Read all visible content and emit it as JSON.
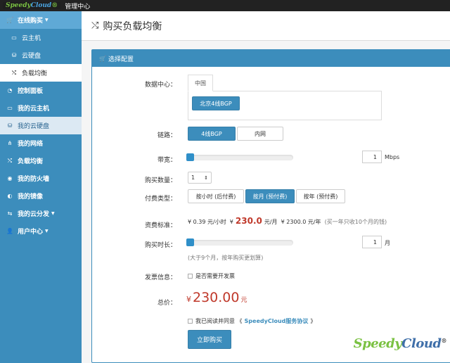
{
  "topbar": {
    "logo_a": "Speedy",
    "logo_b": "Cloud",
    "logo_mark": "®",
    "title": "管理中心"
  },
  "sidebar": {
    "items": [
      {
        "icon": "🛒",
        "label": "在线购买",
        "caret": "▼"
      },
      {
        "icon": "▭",
        "label": "云主机"
      },
      {
        "icon": "⛁",
        "label": "云硬盘"
      },
      {
        "icon": "⤭",
        "label": "负载均衡"
      },
      {
        "icon": "◔",
        "label": "控制面板"
      },
      {
        "icon": "▭",
        "label": "我的云主机"
      },
      {
        "icon": "⛁",
        "label": "我的云硬盘"
      },
      {
        "icon": "⋔",
        "label": "我的网络"
      },
      {
        "icon": "⤭",
        "label": "负载均衡"
      },
      {
        "icon": "◉",
        "label": "我的防火墙"
      },
      {
        "icon": "◐",
        "label": "我的镜像"
      },
      {
        "icon": "⇆",
        "label": "我的云分发",
        "caret": "▼"
      },
      {
        "icon": "👤",
        "label": "用户中心",
        "caret": "▼"
      }
    ]
  },
  "header": {
    "icon": "⤭",
    "title": "购买负载均衡"
  },
  "panel": {
    "icon": "🛒",
    "title": "选择配置"
  },
  "form": {
    "datacenter": {
      "label": "数据中心：",
      "tab": "中国",
      "option": "北京4线BGP"
    },
    "line": {
      "label": "链路：",
      "options": [
        "4线BGP",
        "内网"
      ]
    },
    "bandwidth": {
      "label": "带宽：",
      "value": "1",
      "unit": "Mbps",
      "level": 0.0
    },
    "quantity": {
      "label": "购买数量：",
      "value": "1",
      "arrow": "⇕"
    },
    "billing": {
      "label": "付费类型：",
      "options": [
        "按小时 (后付费)",
        "按月 (预付费)",
        "按年 (预付费)"
      ]
    },
    "price": {
      "label": "资费标准：",
      "cur": "¥",
      "hour_value": "0.39",
      "hour_unit": "元/小时",
      "month_value": "230.0",
      "month_unit": "元/月",
      "year_value": "2300.0",
      "year_unit": "元/年",
      "note": "(买一年只收10个月的钱)"
    },
    "duration": {
      "label": "购买时长：",
      "value": "1",
      "unit": "月",
      "hint": "(大于9个月，按年购买更划算)",
      "level": 0.0
    },
    "invoice": {
      "label": "发票信息：",
      "text": "是否需要开发票"
    },
    "total": {
      "label": "总价：",
      "cur": "¥",
      "amount": "230.00",
      "unit": "元"
    },
    "agree": {
      "text": "我已阅读并同意",
      "open": "《",
      "link": "SpeedyCloud服务协议",
      "close": "》"
    },
    "submit": "立即购买"
  },
  "brand": {
    "a": "Speedy",
    "b": "Cloud",
    "mark": "®"
  },
  "colors": {
    "accent": "#3c8dbc",
    "price": "#c0392b",
    "logo_green": "#7ac142"
  }
}
